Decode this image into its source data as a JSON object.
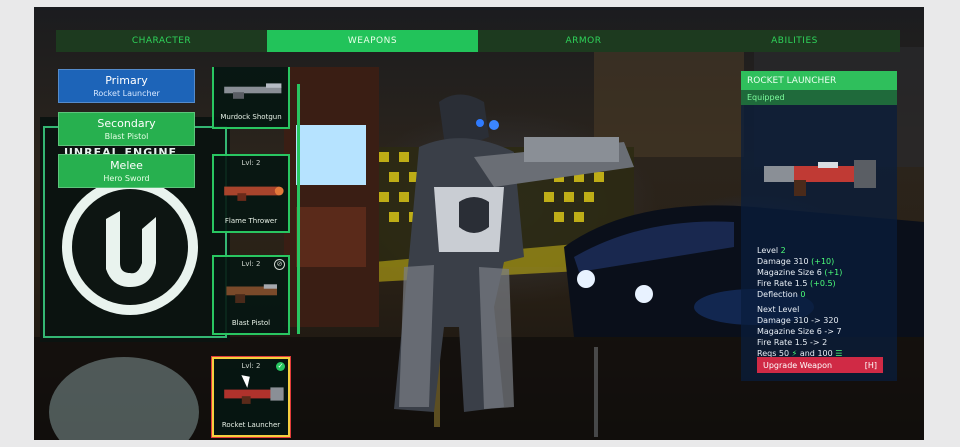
{
  "tabs": [
    {
      "label": "CHARACTER",
      "active": false
    },
    {
      "label": "WEAPONS",
      "active": true
    },
    {
      "label": "ARMOR",
      "active": false
    },
    {
      "label": "ABILITIES",
      "active": false
    }
  ],
  "slots": [
    {
      "title": "Primary",
      "subtitle": "Rocket Launcher"
    },
    {
      "title": "Secondary",
      "subtitle": "Blast Pistol"
    },
    {
      "title": "Melee",
      "subtitle": "Hero Sword"
    }
  ],
  "background_sign": "UNREAL ENGINE",
  "weapon_cards": [
    {
      "level": "",
      "name": "Murdock Shotgun"
    },
    {
      "level": "Lvl: 2",
      "name": "Flame Thrower"
    },
    {
      "level": "Lvl: 2",
      "name": "Blast Pistol"
    },
    {
      "level": "Lvl: 2",
      "name": "Rocket Launcher"
    }
  ],
  "panel": {
    "title": "ROCKET LAUNCHER",
    "status": "Equipped",
    "current": [
      {
        "label": "Level",
        "value": "2",
        "bonus": ""
      },
      {
        "label": "Damage",
        "value": "310",
        "bonus": "(+10)"
      },
      {
        "label": "Magazine Size",
        "value": "6",
        "bonus": "(+1)"
      },
      {
        "label": "Fire Rate",
        "value": "1.5",
        "bonus": "(+0.5)"
      },
      {
        "label": "Deflection",
        "value": "0",
        "bonus": ""
      }
    ],
    "next_title": "Next Level",
    "next": [
      {
        "label": "Damage",
        "value": "310 -> 320"
      },
      {
        "label": "Magazine Size",
        "value": "6 -> 7"
      },
      {
        "label": "Fire Rate",
        "value": "1.5 -> 2"
      }
    ],
    "reqs": {
      "label": "Reqs",
      "amount1": "50",
      "and": "and",
      "amount2": "100"
    },
    "upgrade_label": "Upgrade Weapon",
    "upgrade_key": "[H]"
  },
  "colors": {
    "accent_green": "#22c35a",
    "primary_blue": "#1d64b8",
    "upgrade_red": "#d02a45",
    "highlight_yellow": "#f4d03f"
  }
}
